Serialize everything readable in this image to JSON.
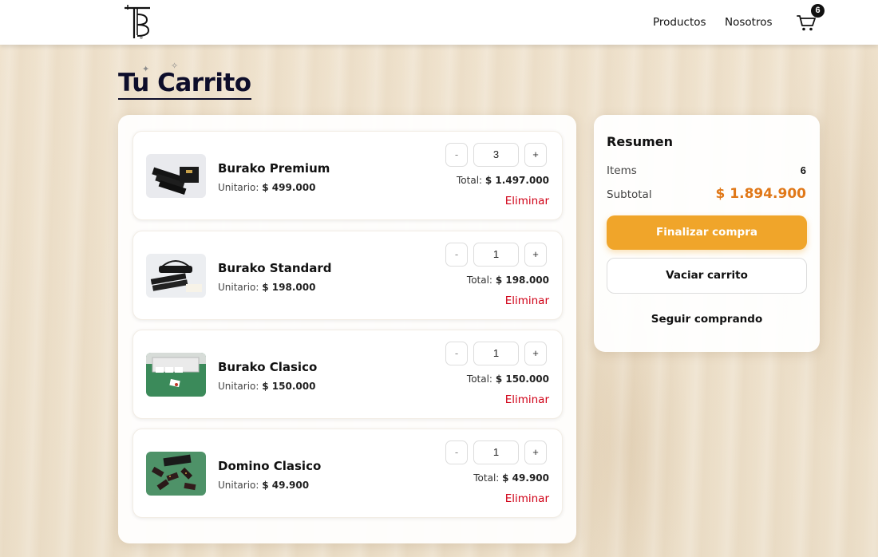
{
  "header": {
    "nav": {
      "products": "Productos",
      "about": "Nosotros"
    },
    "cart_count": "6",
    "icons": {
      "logo": "brand-logo",
      "cart": "cart-icon"
    }
  },
  "page": {
    "title": "Tu Carrito"
  },
  "cart": {
    "items": [
      {
        "name": "Burako Premium",
        "unit_label": "Unitario:",
        "unit_price": "$ 499.000",
        "quantity": "3",
        "total_label": "Total:",
        "total": "$ 1.497.000",
        "remove": "Eliminar",
        "minus": "-",
        "plus": "+"
      },
      {
        "name": "Burako Standard",
        "unit_label": "Unitario:",
        "unit_price": "$ 198.000",
        "quantity": "1",
        "total_label": "Total:",
        "total": "$ 198.000",
        "remove": "Eliminar",
        "minus": "-",
        "plus": "+"
      },
      {
        "name": "Burako Clasico",
        "unit_label": "Unitario:",
        "unit_price": "$ 150.000",
        "quantity": "1",
        "total_label": "Total:",
        "total": "$ 150.000",
        "remove": "Eliminar",
        "minus": "-",
        "plus": "+"
      },
      {
        "name": "Domino Clasico",
        "unit_label": "Unitario:",
        "unit_price": "$ 49.900",
        "quantity": "1",
        "total_label": "Total:",
        "total": "$ 49.900",
        "remove": "Eliminar",
        "minus": "-",
        "plus": "+"
      }
    ]
  },
  "summary": {
    "title": "Resumen",
    "items_label": "Items",
    "items_value": "6",
    "subtotal_label": "Subtotal",
    "subtotal_value": "$ 1.894.900",
    "checkout": "Finalizar compra",
    "clear": "Vaciar carrito",
    "continue": "Seguir comprando"
  },
  "colors": {
    "accent": "#f0a52a",
    "subtotal": "#e07818",
    "remove": "#d00016",
    "title": "#0d0d2a"
  }
}
